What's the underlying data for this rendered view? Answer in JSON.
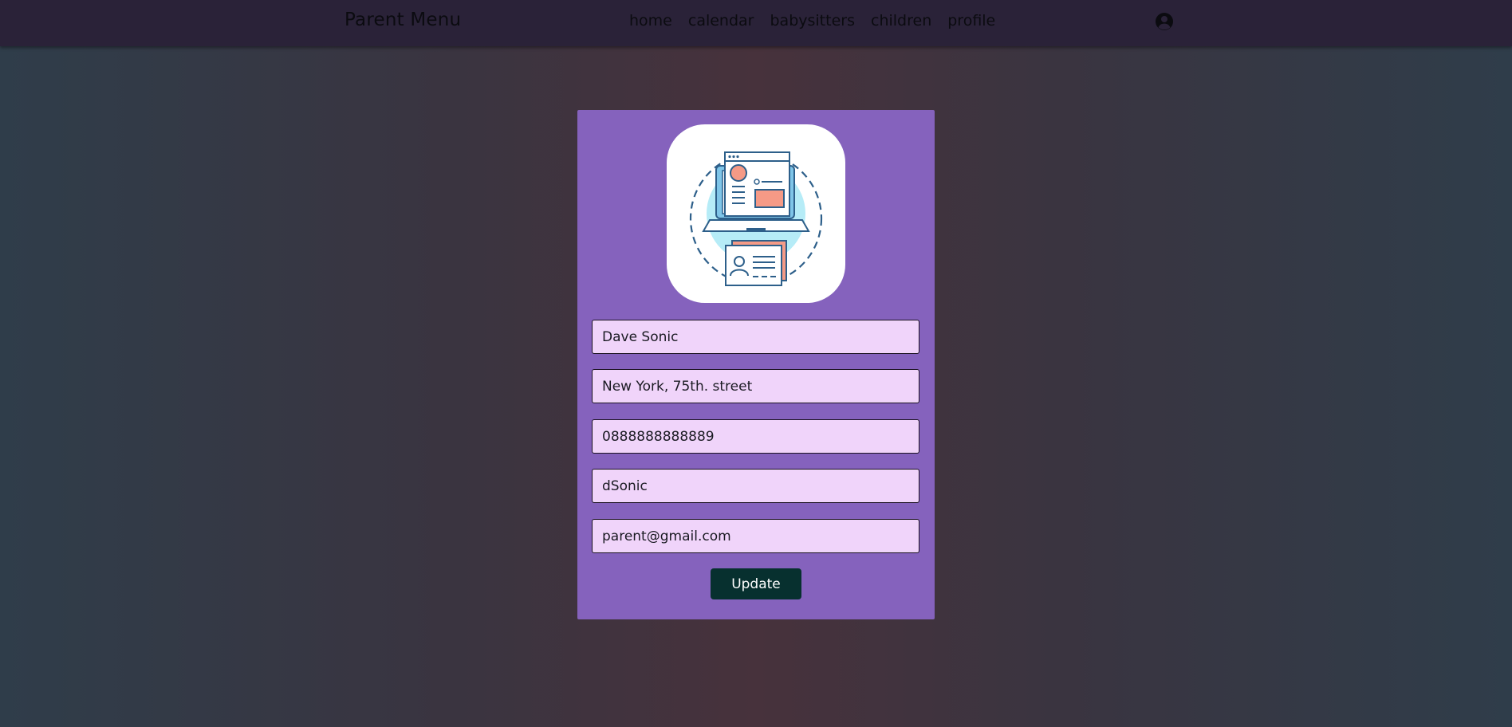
{
  "navbar": {
    "brand": "Parent Menu",
    "links": [
      "home",
      "calendar",
      "babysitters",
      "children",
      "profile"
    ],
    "account_icon": "account-circle-icon"
  },
  "profile_form": {
    "logo_icon": "profile-laptop-id-card-icon",
    "fields": {
      "name": "Dave Sonic",
      "address": "New York, 75th. street",
      "phone": "0888888888889",
      "username": "dSonic",
      "email": "parent@gmail.com"
    },
    "update_label": "Update"
  },
  "colors": {
    "navbar": "#2a2238",
    "card": "#8562bd",
    "input_bg": "#f0d4fa",
    "button": "#07302f"
  }
}
